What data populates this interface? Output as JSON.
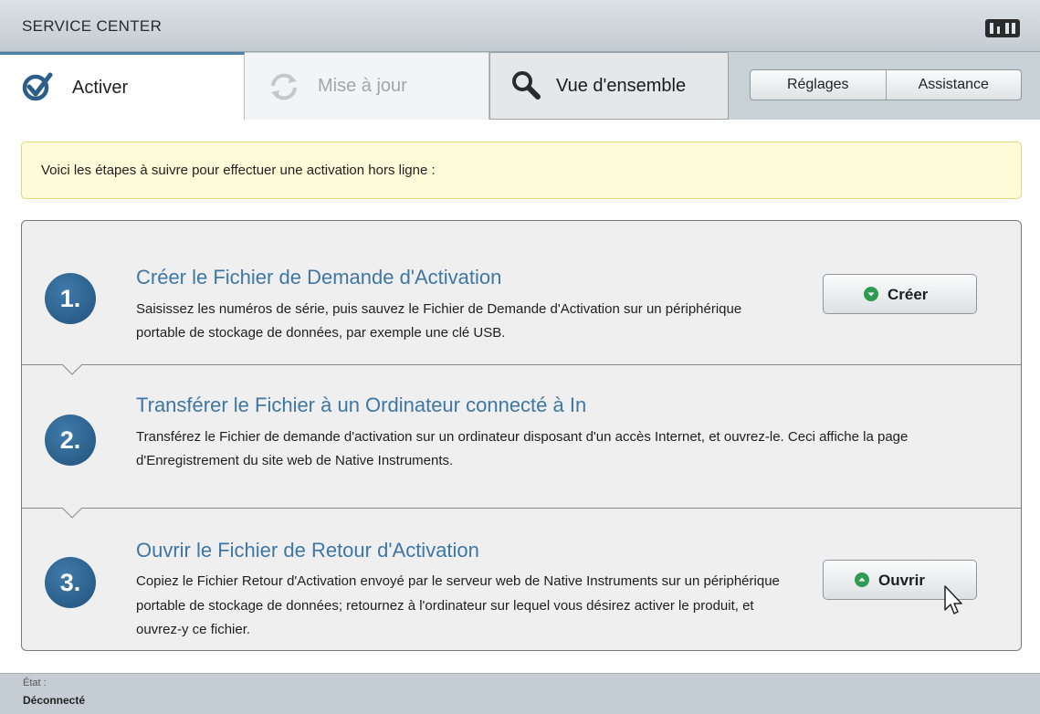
{
  "window": {
    "title": "SERVICE CENTER",
    "logo_icon": "native-instruments-logo"
  },
  "tabs": [
    {
      "label": "Activer",
      "icon": "checkmark-icon",
      "state": "active"
    },
    {
      "label": "Mise à jour",
      "icon": "refresh-icon",
      "state": "disabled"
    },
    {
      "label": "Vue d'ensemble",
      "icon": "search-icon",
      "state": "inactive"
    }
  ],
  "toolbar": {
    "settings_label": "Réglages",
    "support_label": "Assistance"
  },
  "info": {
    "text": "Voici les étapes à suivre pour effectuer une activation hors ligne :"
  },
  "steps": [
    {
      "number": "1.",
      "title": "Créer le Fichier de Demande d'Activation",
      "description": "Saisissez les numéros de série, puis sauvez le Fichier de Demande d'Activation sur un périphérique portable de stockage de données, par exemple une clé USB.",
      "button_label": "Créer",
      "button_icon": "arrow-down-circle-icon"
    },
    {
      "number": "2.",
      "title": "Transférer le Fichier à un Ordinateur connecté à In",
      "description": "Transférez le Fichier de demande d'activation sur un ordinateur disposant d'un accès Internet, et ouvrez-le. Ceci affiche la page d'Enregistrement du site web de Native Instruments."
    },
    {
      "number": "3.",
      "title": "Ouvrir le Fichier de Retour d'Activation",
      "description": "Copiez le Fichier Retour d'Activation envoyé par le serveur web de Native Instruments sur un périphérique portable de stockage de données; retournez à l'ordinateur sur lequel vous désirez activer le produit, et ouvrez-y ce fichier.",
      "button_label": "Ouvrir",
      "button_icon": "arrow-up-circle-icon"
    }
  ],
  "status": {
    "label": "État :",
    "value": "Déconnecté"
  },
  "colors": {
    "accent": "#3e76a4",
    "step_badge": "#2b6390",
    "button_icon_green": "#2f9a52",
    "info_background": "#fdfbd8"
  }
}
